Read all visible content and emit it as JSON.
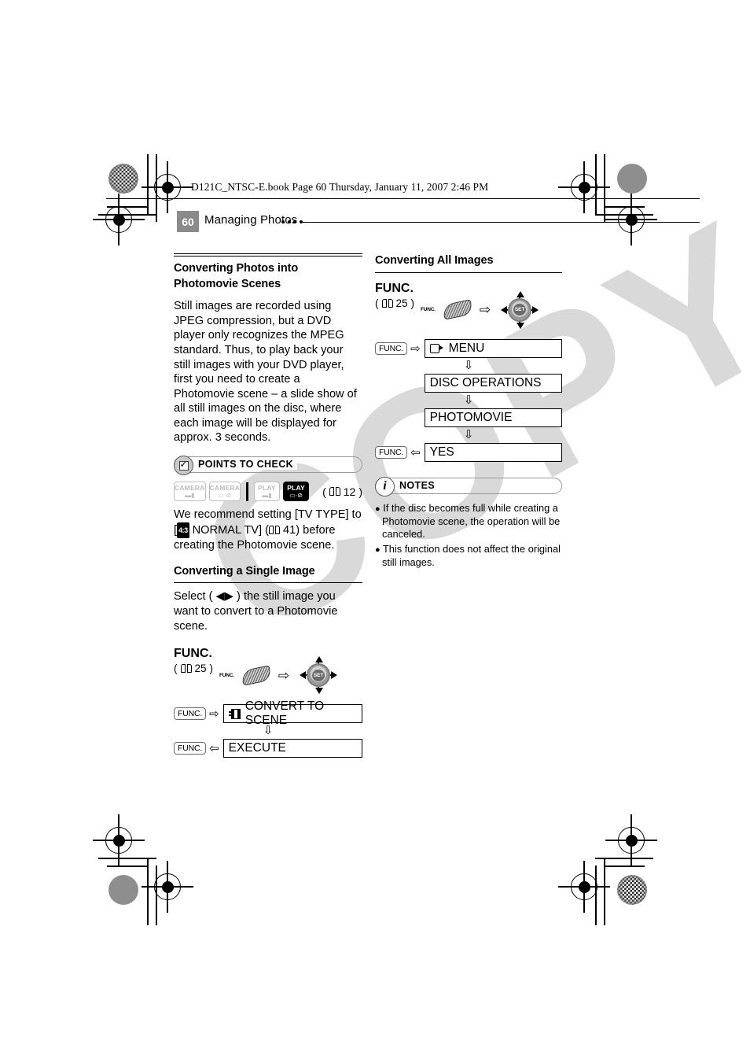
{
  "print_header": {
    "book_line": "D121C_NTSC-E.book  Page 60  Thursday, January 11, 2007  2:46 PM"
  },
  "running_head": {
    "page_number": "60",
    "section_title": "Managing Photos"
  },
  "watermark": {
    "text": "COPY",
    "color": "#d9d9d9"
  },
  "left_column": {
    "heading": "Converting Photos into Photomovie Scenes",
    "body": "Still images are recorded using JPEG compression, but a DVD player only recognizes the MPEG standard. Thus, to play back your still images with your DVD player, first you need to create a Photomovie scene – a slide show of all still images on the disc, where each image will be displayed for approx. 3 seconds.",
    "points_to_check": {
      "label": "POINTS TO CHECK",
      "modes": [
        {
          "title": "CAMERA",
          "glyph": "movie",
          "active": false
        },
        {
          "title": "CAMERA",
          "glyph": "photo",
          "active": false
        },
        {
          "title": "PLAY",
          "glyph": "movie",
          "active": false
        },
        {
          "title": "PLAY",
          "glyph": "photo",
          "active": true
        }
      ],
      "page_ref": "12",
      "text_before": "We recommend setting [TV TYPE] to",
      "text_bracket_open": "[",
      "tv_type_icon": "4:3",
      "tv_type_value": "NORMAL TV]",
      "tv_type_page_ref": "41",
      "text_after": "before creating the Photomovie scene."
    },
    "single_image": {
      "heading": "Converting a Single Image",
      "instruction": "Select ( ◀▶ ) the still image you want to convert to a Photomovie scene.",
      "func_label": "FUNC.",
      "func_page_ref": "25",
      "func_button_caption": "FUNC.",
      "joystick_label": "SET",
      "steps": [
        {
          "key": "FUNC.",
          "arrow": "⇨",
          "icon": "film-icon",
          "label": "CONVERT TO SCENE"
        },
        {
          "key": "FUNC.",
          "arrow": "⇦",
          "icon": "none",
          "label": "EXECUTE"
        }
      ],
      "step_connector": "⇩"
    }
  },
  "right_column": {
    "heading": "Converting All Images",
    "func_label": "FUNC.",
    "func_page_ref": "25",
    "func_button_caption": "FUNC.",
    "joystick_label": "SET",
    "steps": [
      {
        "key": "FUNC.",
        "arrow": "⇨",
        "icon": "cam-icon",
        "label": "MENU"
      },
      {
        "key": "",
        "arrow": "",
        "icon": "none",
        "label": "DISC OPERATIONS"
      },
      {
        "key": "",
        "arrow": "",
        "icon": "none",
        "label": "PHOTOMOVIE"
      },
      {
        "key": "FUNC.",
        "arrow": "⇦",
        "icon": "none",
        "label": "YES"
      }
    ],
    "step_connector": "⇩",
    "notes": {
      "label": "NOTES",
      "items": [
        "If the disc becomes full while creating a Photomovie scene, the operation will be canceled.",
        "This function does not affect the original still images."
      ]
    }
  }
}
